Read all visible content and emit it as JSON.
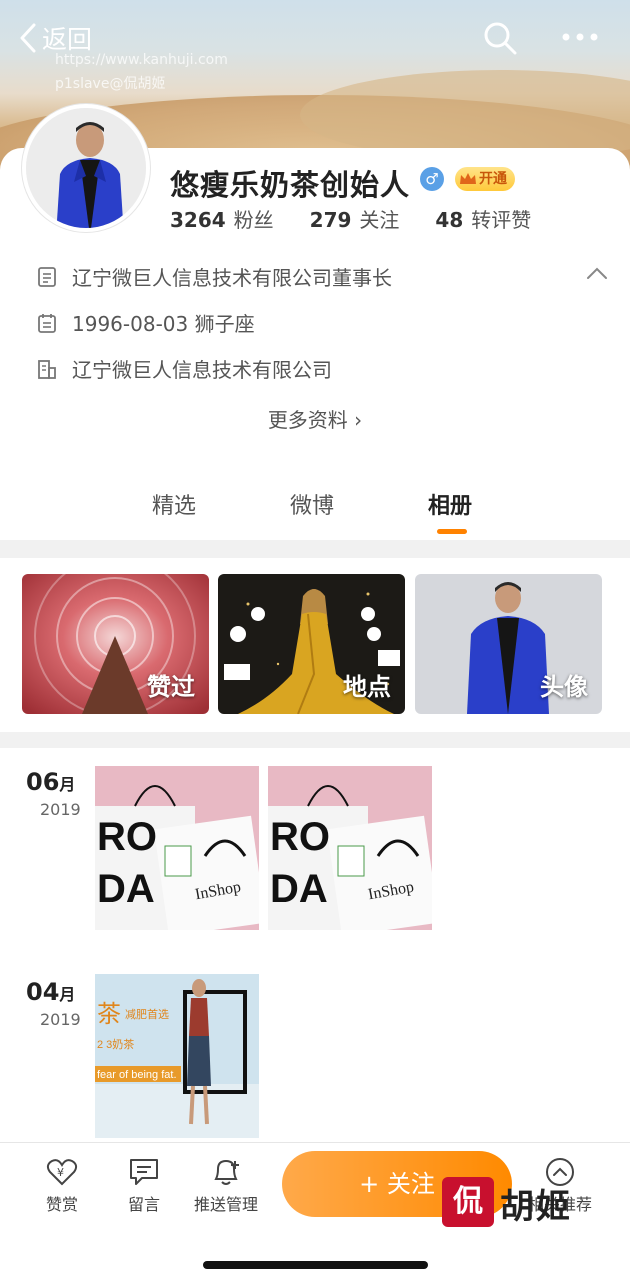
{
  "header": {
    "back_label": "返回",
    "watermark_url": "https://www.kanhuji.com",
    "watermark_user": "p1slave@侃胡姬"
  },
  "profile": {
    "name": "悠瘦乐奶茶创始人",
    "gender_symbol": "♂",
    "vip_label": "开通",
    "stats": [
      {
        "num": "3264",
        "label": "粉丝"
      },
      {
        "num": "279",
        "label": "关注"
      },
      {
        "num": "48",
        "label": "转评赞"
      }
    ],
    "info": [
      {
        "icon": "document-icon",
        "text": "辽宁微巨人信息技术有限公司董事长"
      },
      {
        "icon": "calendar-icon",
        "text": "1996-08-03 狮子座"
      },
      {
        "icon": "building-icon",
        "text": "辽宁微巨人信息技术有限公司"
      }
    ],
    "more_info": "更多资料 ›"
  },
  "tabs": [
    {
      "label": "精选",
      "active": false
    },
    {
      "label": "微博",
      "active": false
    },
    {
      "label": "相册",
      "active": true
    }
  ],
  "albums": [
    {
      "label": "赞过"
    },
    {
      "label": "地点"
    },
    {
      "label": "头像"
    }
  ],
  "timeline": [
    {
      "month": "06",
      "month_unit": "月",
      "year": "2019",
      "photo_count": 2
    },
    {
      "month": "04",
      "month_unit": "月",
      "year": "2019",
      "photo_count": 1
    }
  ],
  "photo_text": {
    "bag_ro": "RO",
    "bag_da": "DA",
    "bag_brand": "InShop",
    "poster_tea": "茶",
    "poster_sub": "减肥首选",
    "poster_line2": "2 3奶茶",
    "poster_line3": "fear of being fat."
  },
  "bottom_bar": {
    "reward": "赞赏",
    "message": "留言",
    "push": "推送管理",
    "follow": "+ 关注",
    "recommend": "相关推荐"
  },
  "watermark_brand": {
    "logo_char": "侃",
    "text": "胡姬"
  },
  "colors": {
    "accent": "#ff8200",
    "follow_gradient_start": "#ffa94a",
    "follow_gradient_end": "#ff8a00",
    "gender_blue": "#5aa0e6"
  }
}
